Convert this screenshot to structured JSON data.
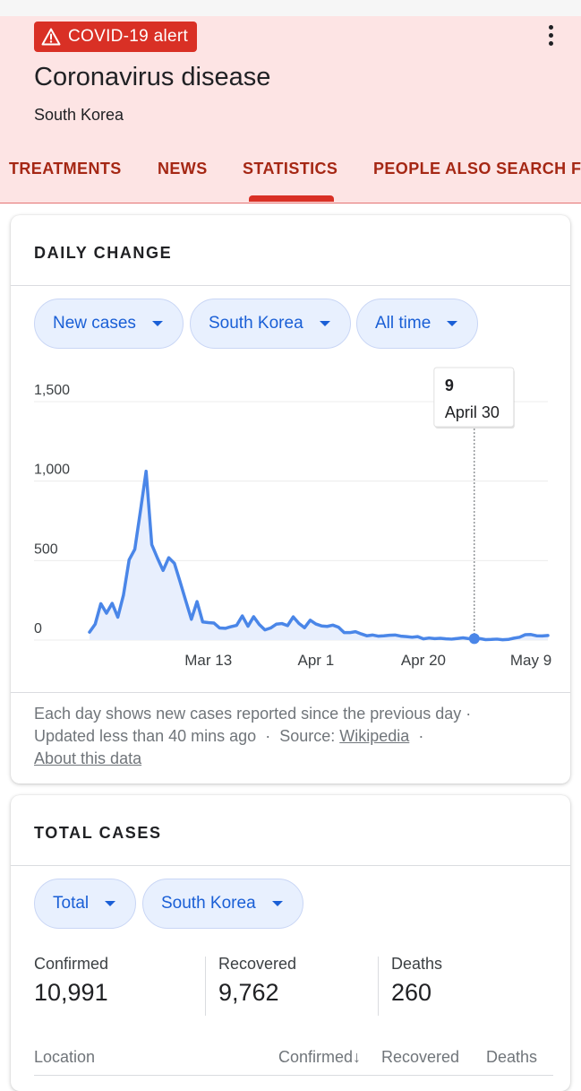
{
  "header": {
    "alert_label": "COVID-19 alert",
    "title": "Coronavirus disease",
    "subtitle": "South Korea",
    "tabs": [
      "TREATMENTS",
      "NEWS",
      "STATISTICS",
      "PEOPLE ALSO SEARCH F"
    ],
    "active_tab": "STATISTICS",
    "accent_color": "#d93025",
    "tab_text_color": "#a52714",
    "background_color": "#fde4e4"
  },
  "daily_change": {
    "title": "DAILY CHANGE",
    "filters": {
      "metric": "New cases",
      "location": "South Korea",
      "range": "All time"
    },
    "tooltip": {
      "value": "9",
      "date": "April 30"
    },
    "footnote": {
      "line1": "Each day shows new cases reported since the previous day ·",
      "updated": "Updated less than 40 mins ago",
      "source_label": "Source:",
      "source_link": "Wikipedia",
      "about_link": "About this data"
    }
  },
  "chart_data": {
    "type": "area",
    "xlabel": "",
    "ylabel": "",
    "ylim": [
      0,
      1500
    ],
    "y_ticks": [
      0,
      500,
      1000,
      1500
    ],
    "y_tick_labels": [
      "0",
      "500",
      "1,000",
      "1,500"
    ],
    "x_tick_labels": [
      {
        "label": "Mar 13",
        "day": 13
      },
      {
        "label": "Apr 1",
        "day": 32
      },
      {
        "label": "Apr 20",
        "day": 51
      },
      {
        "label": "May 9",
        "day": 70
      }
    ],
    "grid": true,
    "series": [
      {
        "color": "#4a86e8",
        "start_day": -8,
        "values": [
          50,
          100,
          229,
          169,
          231,
          144,
          284,
          505,
          571,
          813,
          1062,
          600,
          516,
          438,
          518,
          483,
          367,
          248,
          131,
          242,
          114,
          110,
          107,
          76,
          74,
          84,
          93,
          152,
          87,
          147,
          98,
          64,
          76,
          100,
          104,
          91,
          146,
          105,
          78,
          125,
          101,
          89,
          86,
          94,
          81,
          47,
          47,
          53,
          39,
          27,
          32,
          25,
          27,
          30,
          32,
          25,
          22,
          18,
          22,
          8,
          13,
          9,
          11,
          8,
          6,
          10,
          14,
          9,
          4,
          9,
          3,
          4,
          6,
          2,
          4,
          12,
          18,
          34,
          35,
          27,
          26,
          29
        ]
      }
    ],
    "highlight": {
      "day": 60,
      "value": 9,
      "label": "April 30"
    }
  },
  "total_cases": {
    "title": "TOTAL CASES",
    "filters": {
      "metric": "Total",
      "location": "South Korea"
    },
    "stats": [
      {
        "label": "Confirmed",
        "value": "10,991"
      },
      {
        "label": "Recovered",
        "value": "9,762"
      },
      {
        "label": "Deaths",
        "value": "260"
      }
    ],
    "columns": [
      "Location",
      "Confirmed",
      "Recovered",
      "Deaths"
    ]
  }
}
